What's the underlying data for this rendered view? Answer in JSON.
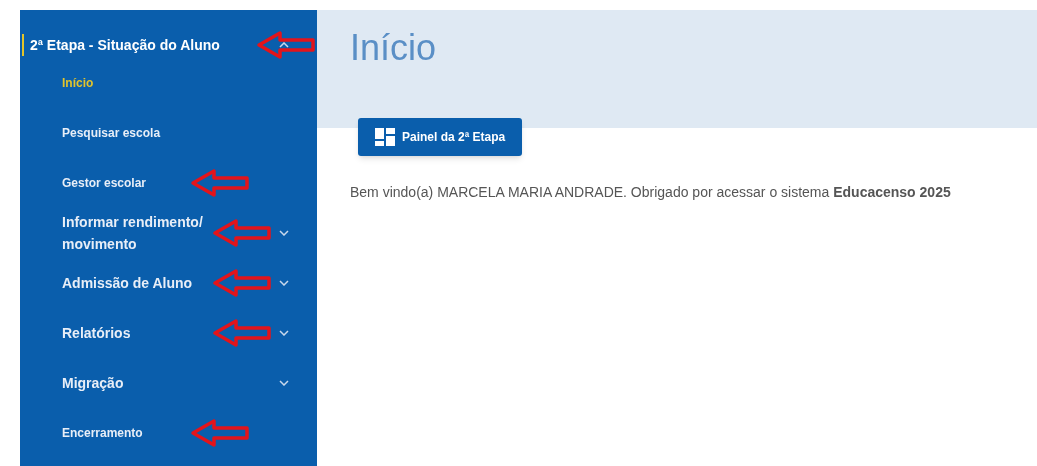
{
  "sidebar": {
    "section": {
      "label": "2ª Etapa - Situação do Aluno",
      "expanded": true,
      "marked": true
    },
    "items": [
      {
        "label": "Início",
        "kind": "link",
        "selected": true,
        "marked": false
      },
      {
        "label": "Pesquisar escola",
        "kind": "link",
        "selected": false,
        "marked": false
      },
      {
        "label": "Gestor escolar",
        "kind": "link",
        "selected": false,
        "marked": true
      },
      {
        "label": "Informar rendimento/ movimento",
        "kind": "group",
        "selected": false,
        "marked": true
      },
      {
        "label": "Admissão de Aluno",
        "kind": "group",
        "selected": false,
        "marked": true
      },
      {
        "label": "Relatórios",
        "kind": "group",
        "selected": false,
        "marked": true
      },
      {
        "label": "Migração",
        "kind": "group",
        "selected": false,
        "marked": false
      },
      {
        "label": "Encerramento",
        "kind": "link",
        "selected": false,
        "marked": true
      }
    ]
  },
  "page": {
    "title": "Início",
    "button": "Painel da 2ª Etapa",
    "welcome": "Bem vindo(a) MARCELA MARIA ANDRADE. Obrigado por acessar o sistema **Educacenso 2025**"
  }
}
